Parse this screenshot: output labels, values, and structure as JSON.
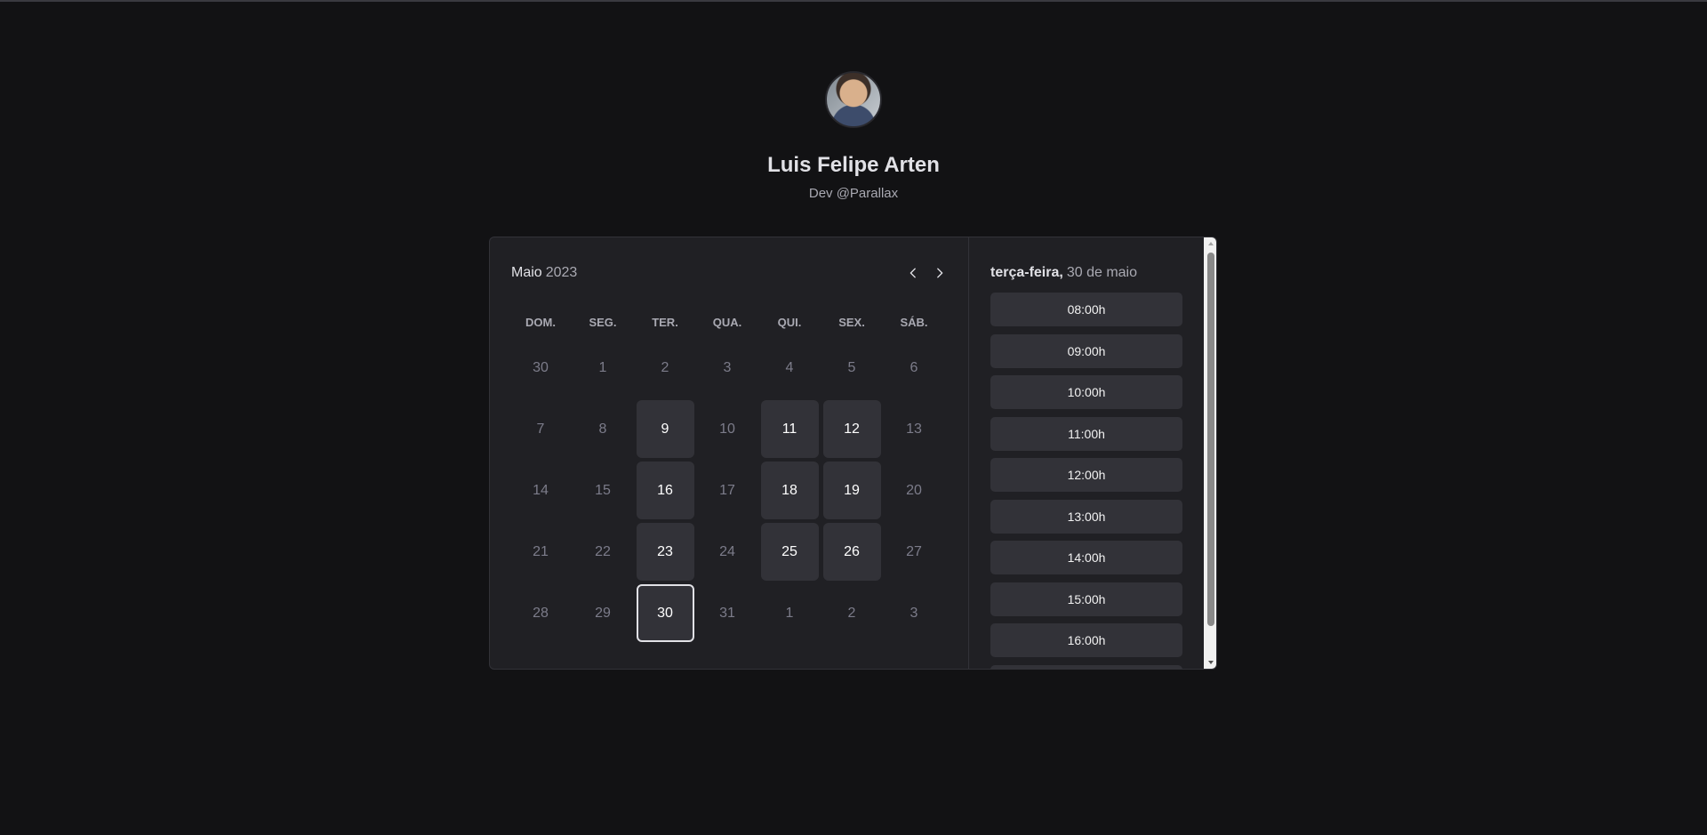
{
  "profile": {
    "name": "Luis Felipe Arten",
    "role": "Dev @Parallax"
  },
  "calendar": {
    "month": "Maio",
    "year": "2023",
    "weekdays": [
      "DOM.",
      "SEG.",
      "TER.",
      "QUA.",
      "QUI.",
      "SEX.",
      "SÁB."
    ],
    "weeks": [
      [
        {
          "d": "30",
          "s": "off"
        },
        {
          "d": "1",
          "s": "off"
        },
        {
          "d": "2",
          "s": "off"
        },
        {
          "d": "3",
          "s": "off"
        },
        {
          "d": "4",
          "s": "off"
        },
        {
          "d": "5",
          "s": "off"
        },
        {
          "d": "6",
          "s": "off"
        }
      ],
      [
        {
          "d": "7",
          "s": "off"
        },
        {
          "d": "8",
          "s": "off"
        },
        {
          "d": "9",
          "s": "available"
        },
        {
          "d": "10",
          "s": "off"
        },
        {
          "d": "11",
          "s": "available"
        },
        {
          "d": "12",
          "s": "available"
        },
        {
          "d": "13",
          "s": "off"
        }
      ],
      [
        {
          "d": "14",
          "s": "off"
        },
        {
          "d": "15",
          "s": "off"
        },
        {
          "d": "16",
          "s": "available"
        },
        {
          "d": "17",
          "s": "off"
        },
        {
          "d": "18",
          "s": "available"
        },
        {
          "d": "19",
          "s": "available"
        },
        {
          "d": "20",
          "s": "off"
        }
      ],
      [
        {
          "d": "21",
          "s": "off"
        },
        {
          "d": "22",
          "s": "off"
        },
        {
          "d": "23",
          "s": "available"
        },
        {
          "d": "24",
          "s": "off"
        },
        {
          "d": "25",
          "s": "available"
        },
        {
          "d": "26",
          "s": "available"
        },
        {
          "d": "27",
          "s": "off"
        }
      ],
      [
        {
          "d": "28",
          "s": "off"
        },
        {
          "d": "29",
          "s": "off"
        },
        {
          "d": "30",
          "s": "selected"
        },
        {
          "d": "31",
          "s": "off"
        },
        {
          "d": "1",
          "s": "off"
        },
        {
          "d": "2",
          "s": "off"
        },
        {
          "d": "3",
          "s": "off"
        }
      ]
    ]
  },
  "times": {
    "weekday": "terça-feira,",
    "date": "30 de maio",
    "slots": [
      "08:00h",
      "09:00h",
      "10:00h",
      "11:00h",
      "12:00h",
      "13:00h",
      "14:00h",
      "15:00h",
      "16:00h",
      ""
    ]
  },
  "icons": {
    "prev": "chevron-left-icon",
    "next": "chevron-right-icon"
  },
  "colors": {
    "background": "#121214",
    "card": "#202024",
    "available_day": "#323238",
    "selected_border": "#e1e1e6"
  }
}
